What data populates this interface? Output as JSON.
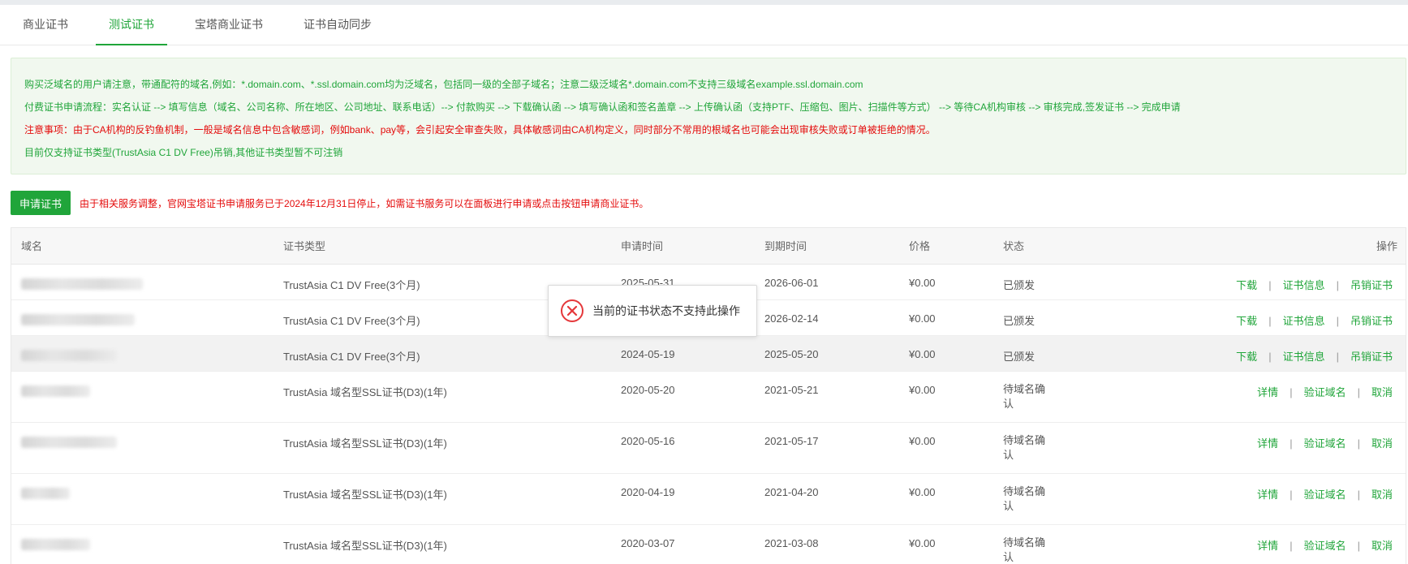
{
  "tabs": [
    {
      "label": "商业证书",
      "active": false
    },
    {
      "label": "测试证书",
      "active": true
    },
    {
      "label": "宝塔商业证书",
      "active": false
    },
    {
      "label": "证书自动同步",
      "active": false
    }
  ],
  "notice": {
    "line1": "购买泛域名的用户请注意，带通配符的域名,例如：*.domain.com、*.ssl.domain.com均为泛域名，包括同一级的全部子域名；注意二级泛域名*.domain.com不支持三级域名example.ssl.domain.com",
    "line2": "付费证书申请流程：实名认证 --> 填写信息（域名、公司名称、所在地区、公司地址、联系电话）--> 付款购买 --> 下载确认函 --> 填写确认函和签名盖章 --> 上传确认函（支持PTF、压缩包、图片、扫描件等方式） --> 等待CA机构审核 --> 审核完成,签发证书 --> 完成申请",
    "line3": "注意事项：由于CA机构的反钓鱼机制，一般是域名信息中包含敏感词，例如bank、pay等，会引起安全审查失败，具体敏感词由CA机构定义，同时部分不常用的根域名也可能会出现审核失败或订单被拒绝的情况。",
    "line4": "目前仅支持证书类型(TrustAsia C1 DV Free)吊销,其他证书类型暂不可注销"
  },
  "toolbar": {
    "apply_label": "申请证书",
    "stop_notice": "由于相关服务调整，官网宝塔证书申请服务已于2024年12月31日停止，如需证书服务可以在面板进行申请或点击按钮申请商业证书。"
  },
  "table": {
    "headers": {
      "domain": "域名",
      "type": "证书类型",
      "apply_time": "申请时间",
      "expire_time": "到期时间",
      "price": "价格",
      "status": "状态",
      "ops": "操作"
    },
    "rows": [
      {
        "type": "TrustAsia C1 DV Free(3个月)",
        "apply_time": "2025-05-31",
        "expire_time": "2026-06-01",
        "price": "¥0.00",
        "status": "已颁发",
        "ops": [
          "下载",
          "证书信息",
          "吊销证书"
        ]
      },
      {
        "type": "TrustAsia C1 DV Free(3个月)",
        "apply_time": "",
        "expire_time": "2026-02-14",
        "price": "¥0.00",
        "status": "已颁发",
        "ops": [
          "下载",
          "证书信息",
          "吊销证书"
        ]
      },
      {
        "type": "TrustAsia C1 DV Free(3个月)",
        "apply_time": "2024-05-19",
        "expire_time": "2025-05-20",
        "price": "¥0.00",
        "status": "已颁发",
        "ops": [
          "下载",
          "证书信息",
          "吊销证书"
        ]
      },
      {
        "type": "TrustAsia 域名型SSL证书(D3)(1年)",
        "apply_time": "2020-05-20",
        "expire_time": "2021-05-21",
        "price": "¥0.00",
        "status": "待域名确认",
        "ops": [
          "详情",
          "验证域名",
          "取消"
        ]
      },
      {
        "type": "TrustAsia 域名型SSL证书(D3)(1年)",
        "apply_time": "2020-05-16",
        "expire_time": "2021-05-17",
        "price": "¥0.00",
        "status": "待域名确认",
        "ops": [
          "详情",
          "验证域名",
          "取消"
        ]
      },
      {
        "type": "TrustAsia 域名型SSL证书(D3)(1年)",
        "apply_time": "2020-04-19",
        "expire_time": "2021-04-20",
        "price": "¥0.00",
        "status": "待域名确认",
        "ops": [
          "详情",
          "验证域名",
          "取消"
        ]
      },
      {
        "type": "TrustAsia 域名型SSL证书(D3)(1年)",
        "apply_time": "2020-03-07",
        "expire_time": "2021-03-08",
        "price": "¥0.00",
        "status": "待域名确认",
        "ops": [
          "详情",
          "验证域名",
          "取消"
        ]
      }
    ]
  },
  "toast": {
    "icon": "error-circle-icon",
    "message": "当前的证书状态不支持此操作"
  },
  "colors": {
    "accent": "#20a53a",
    "warning": "#e40b0b",
    "notice_bg": "#f1f8ef"
  }
}
